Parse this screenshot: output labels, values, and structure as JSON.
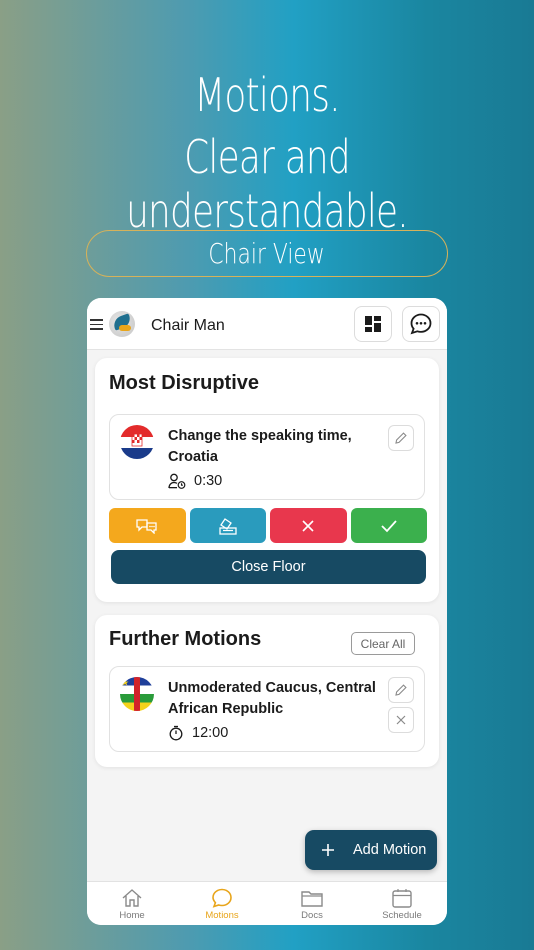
{
  "marketing": {
    "headline_line1": "Motions.",
    "headline_line2": "Clear and understandable.",
    "pill_label": "Chair View"
  },
  "header": {
    "username": "Chair Man",
    "icons": [
      "menu-icon",
      "app-logo",
      "dashboard-icon",
      "chat-icon"
    ]
  },
  "most_disruptive": {
    "title": "Most Disruptive",
    "motion": {
      "title": "Change the speaking time, Croatia",
      "time": "0:30",
      "flag": "croatia-flag"
    },
    "actions": [
      {
        "icon": "speech-bubbles-icon",
        "color": "#f4a81d"
      },
      {
        "icon": "vote-icon",
        "color": "#2a9bbd"
      },
      {
        "icon": "close-icon",
        "color": "#e8374d"
      },
      {
        "icon": "check-icon",
        "color": "#3bb04d"
      }
    ],
    "close_floor_label": "Close Floor"
  },
  "further_motions": {
    "title": "Further Motions",
    "clear_all_label": "Clear All",
    "motions": [
      {
        "title": "Unmoderated Caucus, Central African Republic",
        "time": "12:00",
        "flag": "central-african-republic-flag"
      }
    ]
  },
  "fab": {
    "label": "Add Motion",
    "icon": "plus-icon"
  },
  "nav": {
    "items": [
      {
        "label": "Home",
        "icon": "home-icon"
      },
      {
        "label": "Motions",
        "icon": "speech-bubble-icon",
        "active": true
      },
      {
        "label": "Docs",
        "icon": "folder-icon"
      },
      {
        "label": "Schedule",
        "icon": "calendar-icon"
      }
    ]
  },
  "colors": {
    "accent": "#e8a51b",
    "primary_dark": "#174a63"
  }
}
